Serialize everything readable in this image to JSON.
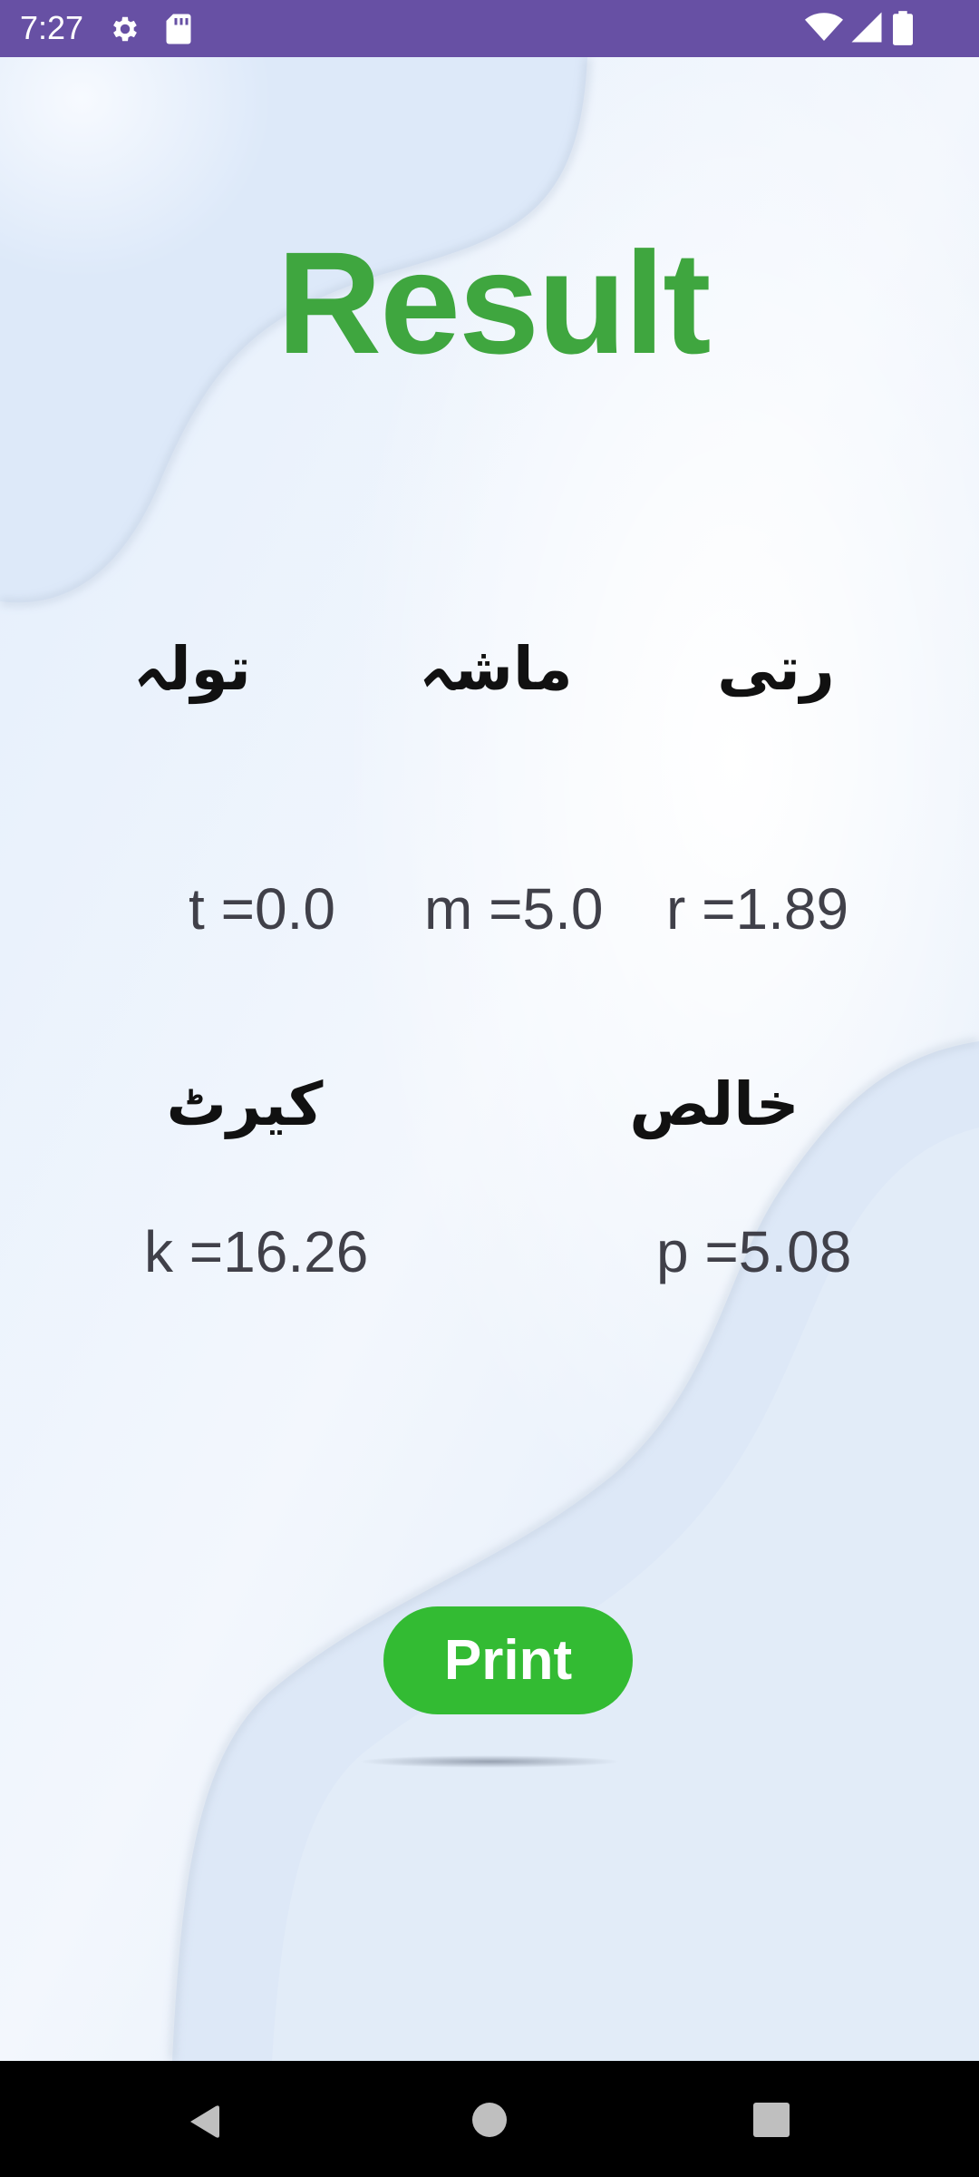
{
  "colors": {
    "status_bar": "#6750a4",
    "title_green": "#3fa63f",
    "button_green": "#33bb33",
    "button_text": "#ffffff",
    "value_text": "#404049",
    "label_text": "#111111",
    "nav_bar": "#000000"
  },
  "status_bar": {
    "time": "7:27",
    "left_icons": [
      "gear-icon",
      "sdcard-icon"
    ],
    "right_icons": [
      "wifi-icon",
      "signal-icon",
      "battery-icon"
    ]
  },
  "screen": {
    "title": "Result",
    "labels": {
      "tola": "تولہ",
      "masha": "ماشہ",
      "ratti": "رتی",
      "carat": "کیرٹ",
      "pure": "خالص"
    },
    "values": {
      "t": "t =0.0",
      "m": "m =5.0",
      "r": "r =1.89",
      "k": "k =16.26",
      "p": "p =5.08"
    },
    "print_label": "Print"
  },
  "nav_bar": {
    "buttons": [
      "back-icon",
      "home-icon",
      "recents-icon"
    ]
  }
}
